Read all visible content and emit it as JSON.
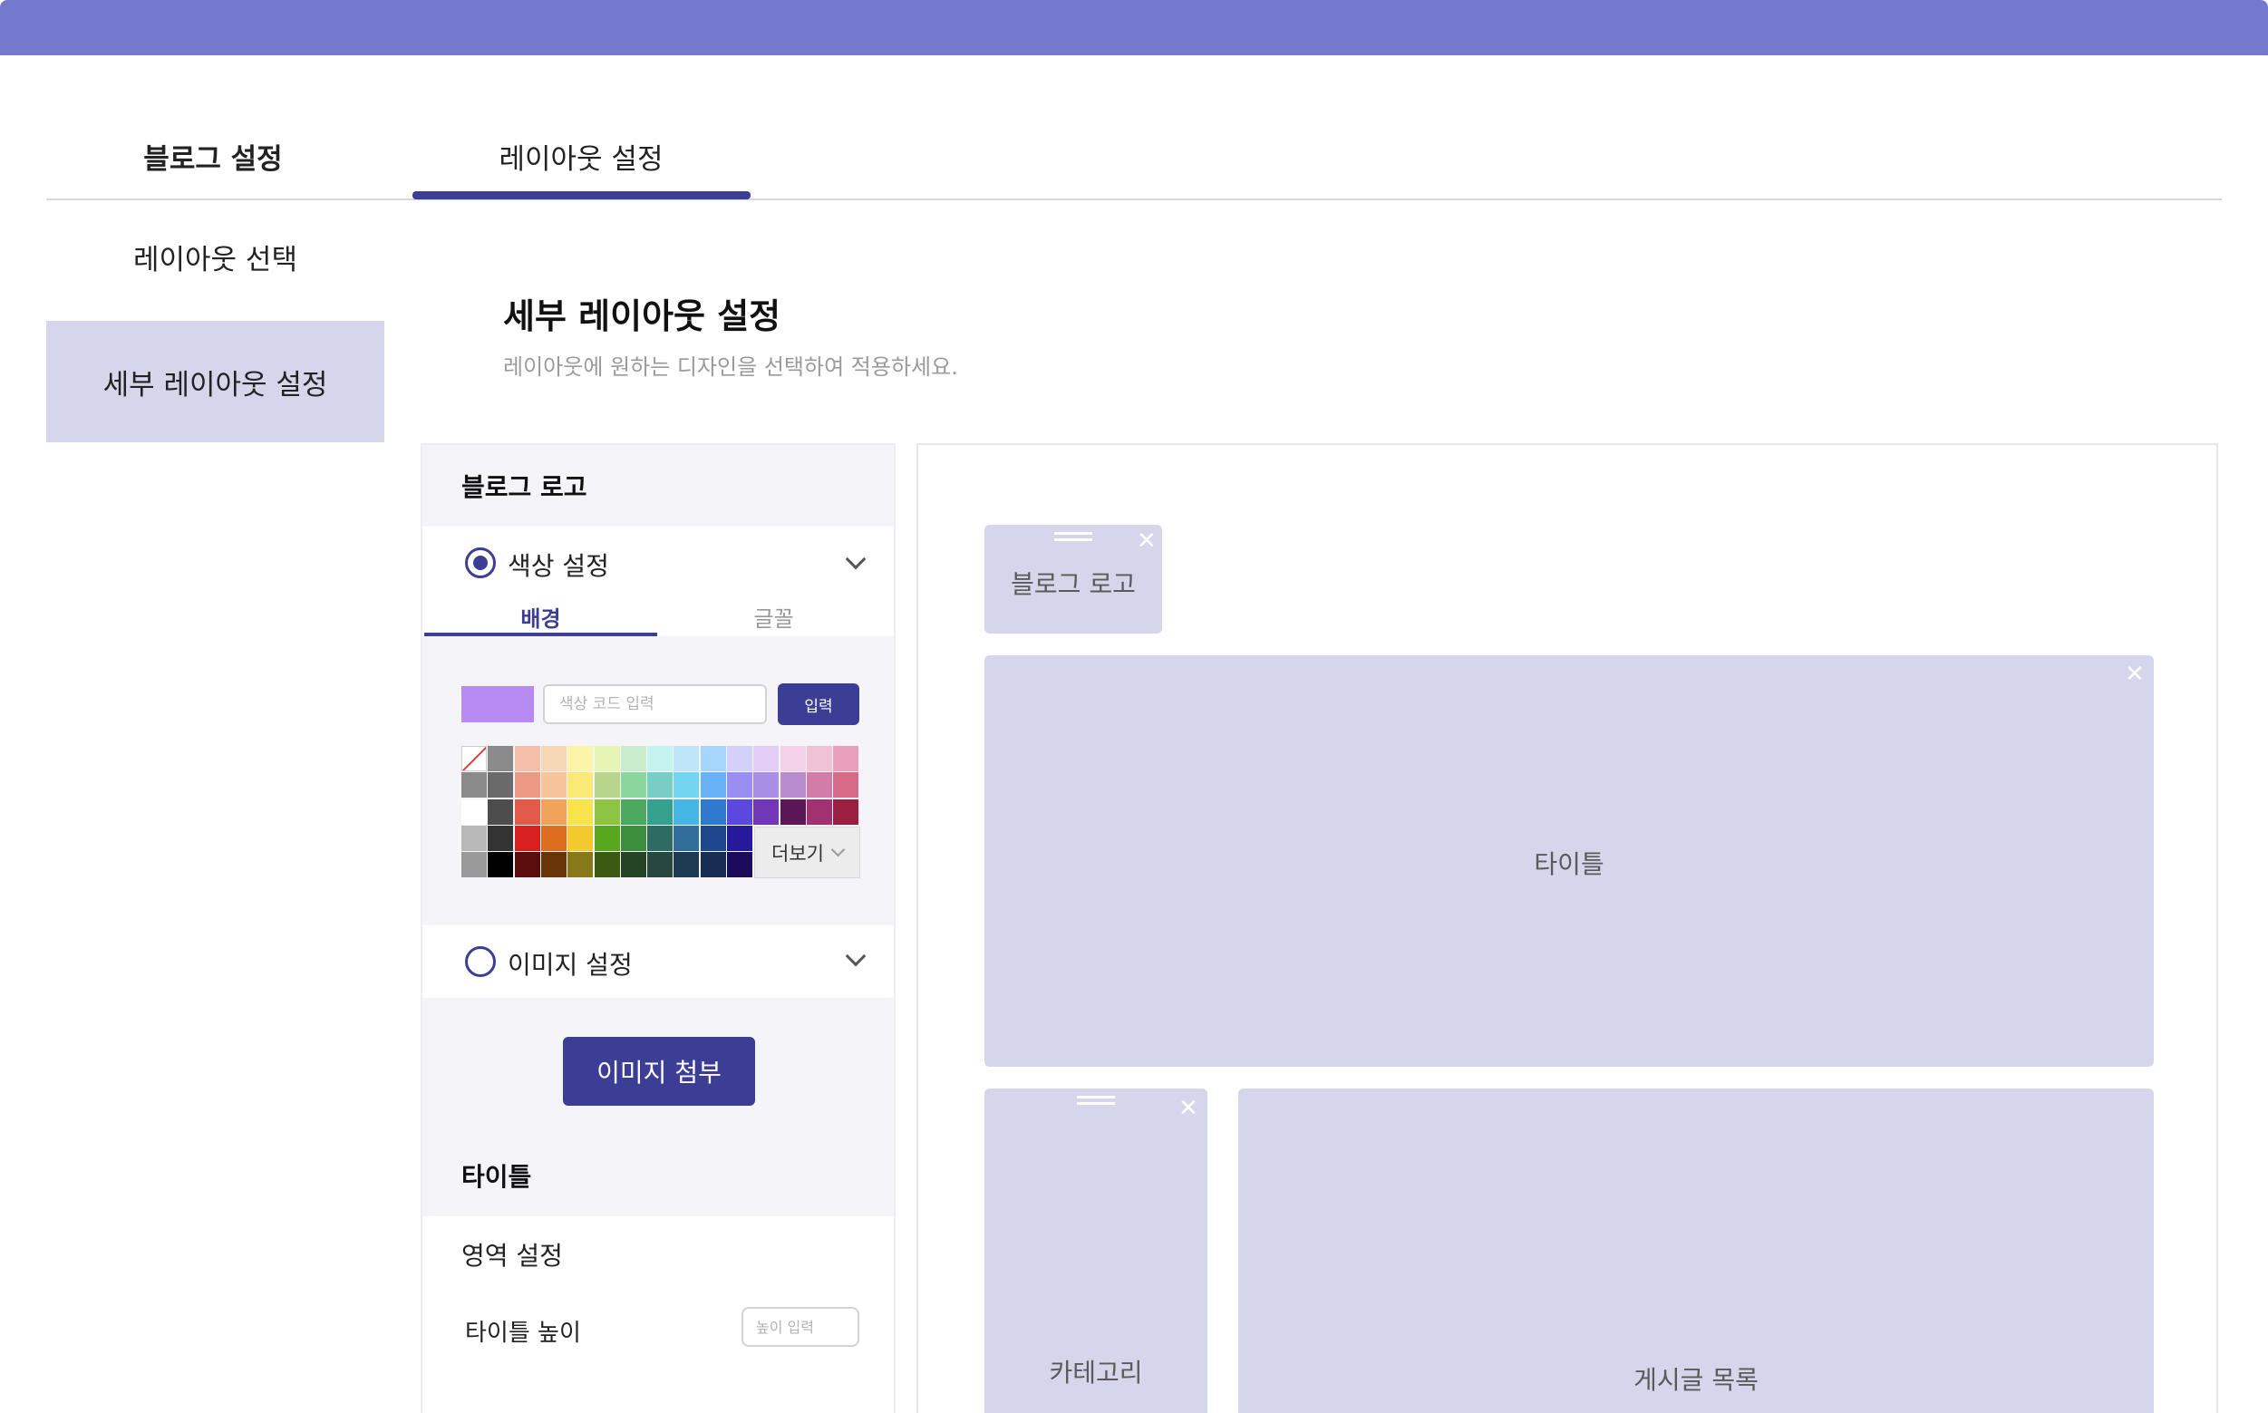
{
  "tabs": {
    "blog_settings": "블로그 설정",
    "layout_settings": "레이아웃 설정"
  },
  "sidebar": {
    "items": [
      {
        "label": "레이아웃 선택"
      },
      {
        "label": "세부 레이아웃 설정"
      }
    ]
  },
  "main": {
    "title": "세부 레이아웃 설정",
    "subtitle": "레이아웃에 원하는 디자인을 선택하여 적용하세요."
  },
  "panel": {
    "logo_section": {
      "title": "블로그 로고",
      "color_option": "색상 설정",
      "subtabs": [
        "배경",
        "글꼴"
      ],
      "selected_color": "#b78bf4",
      "color_code_placeholder": "색상 코드 입력",
      "enter_button": "입력",
      "more_button": "더보기",
      "image_option": "이미지 설정",
      "attach_button": "이미지 첨부"
    },
    "title_section": {
      "title": "타이틀",
      "area_setting": "영역 설정",
      "height_label": "타이틀 높이",
      "height_placeholder": "높이 입력"
    }
  },
  "palette": {
    "left_column": [
      "none",
      "#8a8a8a",
      "#ffffff",
      "#b9b9b9",
      "#9a9a9a"
    ],
    "rows": [
      [
        "#8a8a8a",
        "#f3bfa9",
        "#f6d7b6",
        "#fcf4a7",
        "#e6f4b4",
        "#c9eccd",
        "#c5f3f0",
        "#bfe6f8",
        "#a6d6fb",
        "#d3d0f9",
        "#e2cdf6",
        "#f3d1e8",
        "#f0c3d4",
        "#ea9fbb"
      ],
      [
        "#6a6a6a",
        "#ec9a86",
        "#f6c39a",
        "#fbe977",
        "#b7d58b",
        "#8ad69c",
        "#79cdc4",
        "#74d5f1",
        "#6ab2f7",
        "#9b8ef3",
        "#a98ee6",
        "#b88ccd",
        "#d17ca9",
        "#d86b87"
      ],
      [
        "#4d4d4d",
        "#e25a48",
        "#f1a35b",
        "#f7e34b",
        "#8ec441",
        "#4aa85f",
        "#37a18f",
        "#44b7e7",
        "#2f79cf",
        "#5a48df",
        "#7137b7",
        "#5c1656",
        "#a13271",
        "#9b1f3e"
      ],
      [
        "#333333",
        "#d8201e",
        "#dc6e1e",
        "#f4c92c",
        "#57a81d",
        "#3a8e3c",
        "#2e6c63",
        "#316e9c",
        "#1d468f",
        "#251a9b",
        "#ffffff",
        "#ffffff",
        "#ffffff",
        "#ffffff"
      ],
      [
        "#000000",
        "#5b0d0d",
        "#6a3409",
        "#87791a",
        "#3c5b11",
        "#254325",
        "#27473f",
        "#1d3c54",
        "#172e52",
        "#1a0c5a",
        "#ffffff",
        "#ffffff",
        "#ffffff",
        "#ffffff"
      ]
    ]
  },
  "preview": {
    "blocks": {
      "logo": "블로그 로고",
      "title": "타이틀",
      "category": "카테고리",
      "posts": "게시글 목록"
    }
  }
}
